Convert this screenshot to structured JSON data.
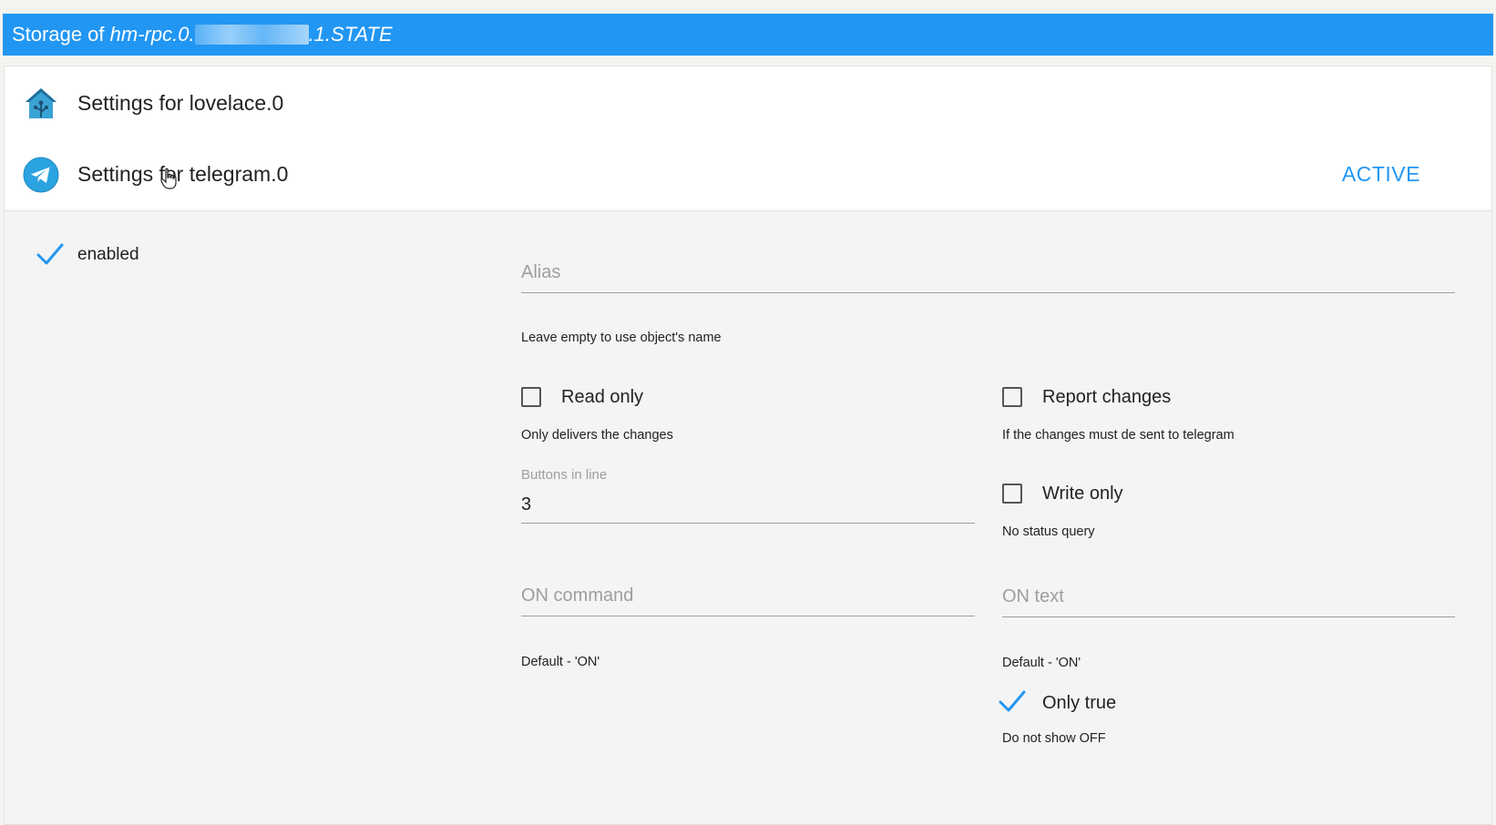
{
  "title": {
    "prefix": "Storage of ",
    "object_start": "hm-rpc.0.",
    "object_end": ".1.STATE"
  },
  "instances": [
    {
      "label": "Settings for lovelace.0",
      "icon": "lovelace-home-icon"
    },
    {
      "label": "Settings for telegram.0",
      "icon": "telegram-icon",
      "status": "ACTIVE"
    }
  ],
  "settings": {
    "enabled": {
      "label": "enabled",
      "checked": true
    },
    "alias": {
      "placeholder": "Alias",
      "value": "",
      "hint": "Leave empty to use object's name"
    },
    "read_only": {
      "label": "Read only",
      "checked": false,
      "hint": "Only delivers the changes"
    },
    "report_changes": {
      "label": "Report changes",
      "checked": false,
      "hint": "If the changes must de sent to telegram"
    },
    "buttons_in_line": {
      "label": "Buttons in line",
      "value": "3"
    },
    "write_only": {
      "label": "Write only",
      "checked": false,
      "hint": "No status query"
    },
    "on_command": {
      "placeholder": "ON command",
      "value": "",
      "hint": "Default - 'ON'"
    },
    "on_text": {
      "placeholder": "ON text",
      "value": "",
      "hint": "Default - 'ON'"
    },
    "only_true": {
      "label": "Only true",
      "checked": true,
      "hint": "Do not show OFF"
    }
  },
  "colors": {
    "accent": "#2196f3",
    "background": "#f4f4f4",
    "header": "#ffffff"
  }
}
